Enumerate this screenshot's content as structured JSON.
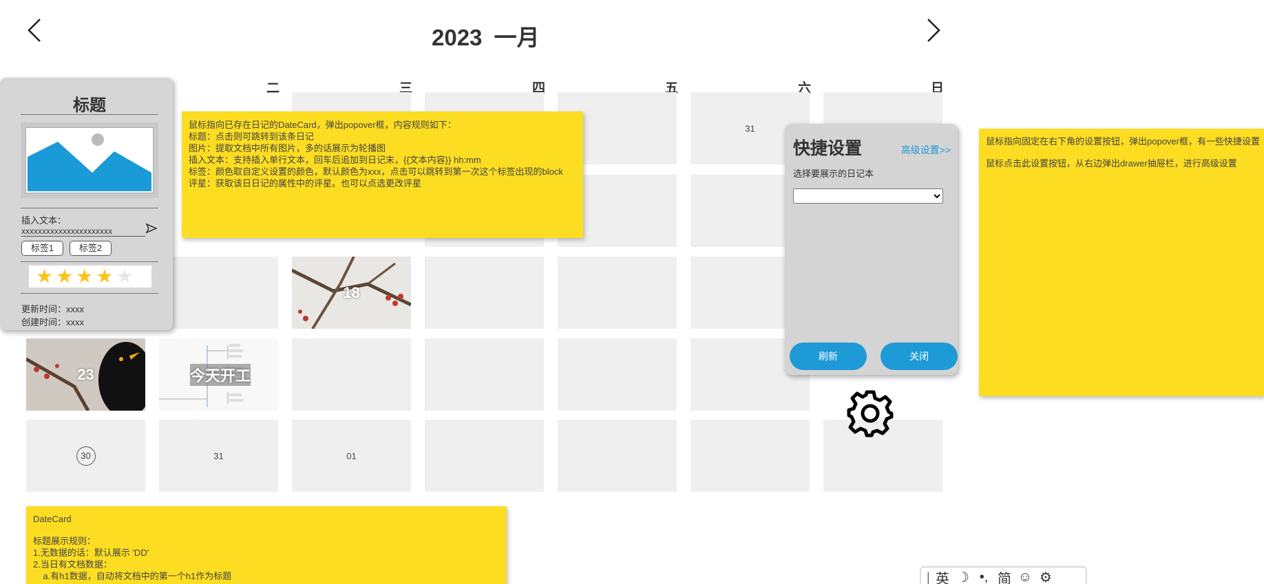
{
  "header": {
    "title": "2023  一月",
    "prev_icon": "chevron-left-icon",
    "next_icon": "chevron-right-icon"
  },
  "weekdays": [
    "二",
    "三",
    "四",
    "五",
    "六",
    "日"
  ],
  "calendar": {
    "row1": {
      "sat": "31"
    },
    "row3": {
      "wed": "18"
    },
    "row4": {
      "mon": "23",
      "tue": "今天开工"
    },
    "row5": {
      "mon": "30",
      "tue": "31",
      "wed": "01"
    }
  },
  "card": {
    "title": "标题",
    "insert_label": "插入文本：",
    "insert_value": "xxxxxxxxxxxxxxxxxxxxxx",
    "tags": [
      "标签1",
      "标签2"
    ],
    "rating": 4,
    "rating_max": 5,
    "star_color": "#fcc419",
    "updated": "更新时间：xxxx",
    "created": "创建时间：xxxx"
  },
  "note_top": {
    "lines": [
      "鼠标指向已存在日记的DateCard，弹出popover框，内容规则如下：",
      "标题：点击则可跳转到该条日记",
      "图片：提取文档中所有图片，多的话展示为轮播图",
      "插入文本：支持插入单行文本，回车后追加到日记末，{{文本内容}}   hh:mm",
      "标签：颜色取自定义设置的颜色，默认颜色为xxx，点击可以跳转到第一次这个标签出现的block",
      "评星：获取该日日记的属性中的评星。也可以点选更改评星"
    ]
  },
  "note_right": {
    "lines": [
      "鼠标指向固定在右下角的设置按钮，弹出popover框，有一些快捷设置",
      "鼠标点击此设置按钮，从右边弹出drawer抽屉栏，进行高级设置"
    ]
  },
  "note_bottom": {
    "heading": "DateCard",
    "lines": [
      "标题展示规则：",
      "1.无数据的话：默认展示 'DD'",
      "2.当日有文档数据：",
      "    a.有h1数据，自动将文档中的第一个h1作为标题"
    ]
  },
  "quick": {
    "title": "快捷设置",
    "advanced": "高级设置>>",
    "label": "选择要展示的日记本",
    "select_value": "",
    "refresh": "刷新",
    "close": "关闭"
  },
  "ime": [
    "英",
    "简"
  ],
  "colors": {
    "note": "#fcdd22",
    "accent": "#1e9ad6",
    "cell": "#efefef",
    "panel": "#d6d6d6"
  }
}
